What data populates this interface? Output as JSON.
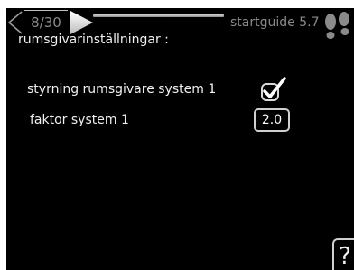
{
  "header": {
    "page_counter": "8/30",
    "title": "startguide 5.7",
    "prev_icon": "chevron-left-icon",
    "next_icon": "play-arrow-icon",
    "guide_icon": "footprints-icon"
  },
  "main": {
    "section_title": "rumsgivarinställningar :",
    "rows": [
      {
        "label": "styrning rumsgivare system 1",
        "checked": true
      },
      {
        "label": "faktor system 1",
        "value": "2.0"
      }
    ]
  },
  "help": {
    "label": "?"
  },
  "colors": {
    "background": "#000000",
    "text": "#f0f0f0",
    "muted": "#8a8a8a"
  }
}
